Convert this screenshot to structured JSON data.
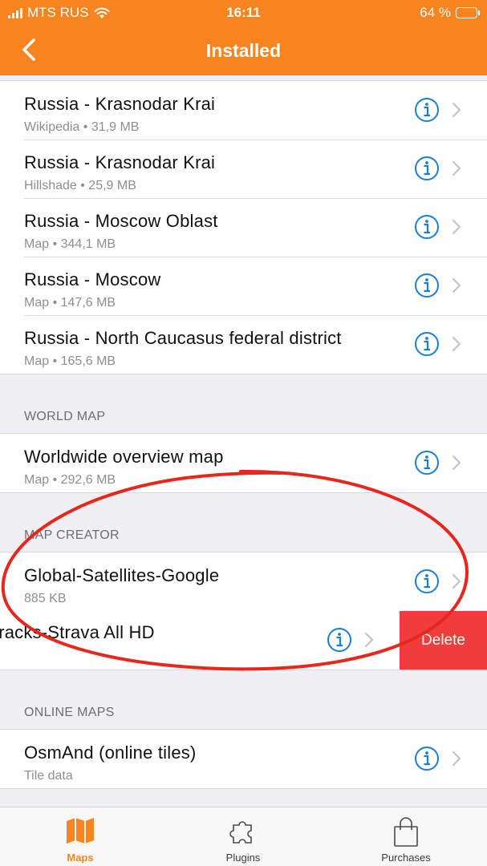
{
  "status_bar": {
    "carrier": "MTS RUS",
    "time": "16:11",
    "battery": "64 %",
    "battery_level": 0.64
  },
  "nav": {
    "title": "Installed"
  },
  "top_group": [
    {
      "title": "Russia - Krasnodar Krai",
      "subtitle": "Wikipedia • 31,9 MB"
    },
    {
      "title": "Russia - Krasnodar Krai",
      "subtitle": "Hillshade • 25,9 MB"
    },
    {
      "title": "Russia - Moscow Oblast",
      "subtitle": "Map • 344,1 MB"
    },
    {
      "title": "Russia - Moscow",
      "subtitle": "Map • 147,6 MB"
    },
    {
      "title": "Russia - North Caucasus federal district",
      "subtitle": "Map • 165,6 MB"
    }
  ],
  "world_map": {
    "header": "WORLD MAP",
    "items": [
      {
        "title": "Worldwide overview map",
        "subtitle": "Map • 292,6 MB"
      }
    ]
  },
  "map_creator": {
    "header": "MAP CREATOR",
    "items": [
      {
        "title": "Global-Satellites-Google",
        "subtitle": "885 KB"
      }
    ],
    "swiped_item": {
      "title": "y GPS tracks-Strava All HD",
      "delete_label": "Delete"
    }
  },
  "online_maps": {
    "header": "ONLINE MAPS",
    "items": [
      {
        "title": "OsmAnd (online tiles)",
        "subtitle": "Tile data"
      }
    ]
  },
  "tabs": [
    {
      "label": "Maps",
      "icon": "map-icon",
      "active": true
    },
    {
      "label": "Plugins",
      "icon": "puzzle-icon",
      "active": false
    },
    {
      "label": "Purchases",
      "icon": "shopping-bag-icon",
      "active": false
    }
  ],
  "colors": {
    "accent": "#f7841e",
    "info_blue": "#1a7ed6",
    "delete_red": "#f03c3c",
    "annotation_red": "#e8261c"
  }
}
